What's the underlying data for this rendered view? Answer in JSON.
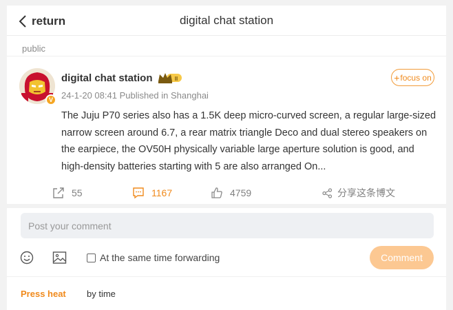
{
  "header": {
    "back_label": "return",
    "title": "digital chat station"
  },
  "visibility": "public",
  "post": {
    "author": "digital chat station",
    "avatar_badge": "V",
    "level_badge": "II",
    "meta": "24-1-20 08:41  Published in Shanghai",
    "follow_label": "focus on",
    "content": "The Juju P70 series also has a 1.5K deep micro-curved screen, a regular large-sized narrow screen around 6.7, a rear matrix triangle Deco and dual stereo speakers on the earpiece, the OV50H physically variable large aperture solution is good, and high-density batteries starting with 5 are also arranged On..."
  },
  "actions": {
    "repost_count": "55",
    "comment_count": "1167",
    "like_count": "4759",
    "share_label": "分享这条博文"
  },
  "comment": {
    "placeholder": "Post your comment",
    "forward_label": "At the same time forwarding",
    "submit_label": "Comment"
  },
  "sort": {
    "heat_label": "Press heat",
    "time_label": "by time"
  },
  "colors": {
    "accent": "#f08a1c",
    "submit_disabled": "#fcc892",
    "input_bg": "#eef0f3"
  }
}
